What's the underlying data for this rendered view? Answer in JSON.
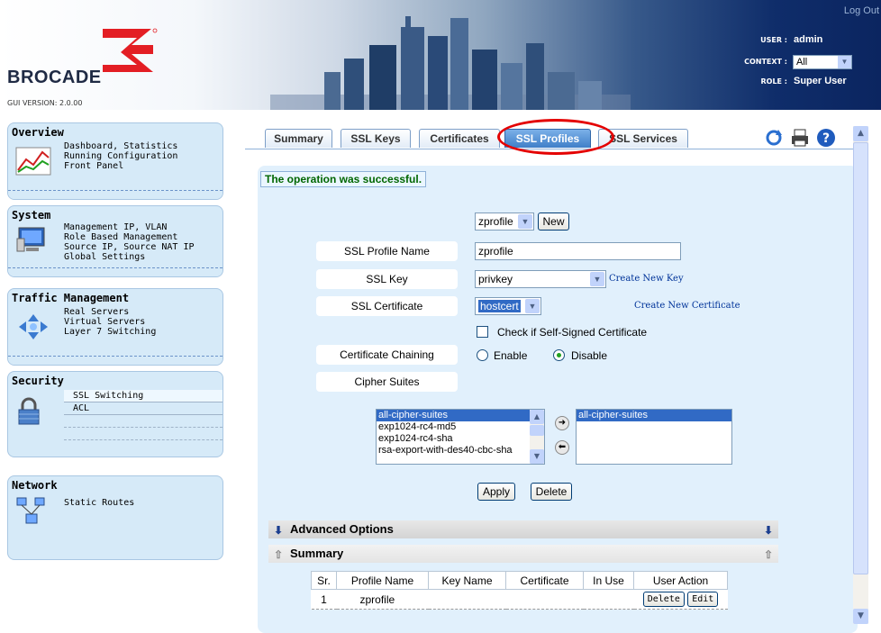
{
  "header": {
    "brand": "BROCADE",
    "gui_version": "GUI VERSION: 2.0.00",
    "logout": "Log Out",
    "user_label": "USER :",
    "user_value": "admin",
    "context_label": "CONTEXT :",
    "context_value": "All",
    "role_label": "ROLE :",
    "role_value": "Super User",
    "brand_color": "#e31e24"
  },
  "sidebar": {
    "overview": {
      "title": "Overview",
      "links": [
        "Dashboard, Statistics",
        "Running Configuration",
        "Front Panel"
      ]
    },
    "system": {
      "title": "System",
      "links": [
        "Management IP, VLAN",
        "Role Based Management",
        "Source IP, Source NAT IP",
        "Global Settings"
      ]
    },
    "traffic": {
      "title": "Traffic Management",
      "links": [
        "Real Servers",
        "Virtual Servers",
        "Layer 7 Switching"
      ]
    },
    "security": {
      "title": "Security",
      "links": [
        "SSL Switching",
        "ACL"
      ]
    },
    "network": {
      "title": "Network",
      "links": [
        "Static Routes"
      ]
    }
  },
  "tabs": [
    {
      "label": "Summary",
      "active": false
    },
    {
      "label": "SSL Keys",
      "active": false
    },
    {
      "label": "Certificates",
      "active": false
    },
    {
      "label": "SSL Profiles",
      "active": true
    },
    {
      "label": "SSL Services",
      "active": false
    }
  ],
  "status_message": "The operation was successful.",
  "form": {
    "profile_select": "zprofile",
    "new_button": "New",
    "profile_name_label": "SSL Profile Name",
    "profile_name_value": "zprofile",
    "ssl_key_label": "SSL Key",
    "ssl_key_value": "privkey",
    "create_key_link": "Create New Key",
    "ssl_cert_label": "SSL Certificate",
    "ssl_cert_value": "hostcert",
    "create_cert_link": "Create New Certificate",
    "self_signed_label": "Check if Self-Signed Certificate",
    "chaining_label": "Certificate Chaining",
    "enable_label": "Enable",
    "disable_label": "Disable",
    "chaining_value": "Disable",
    "cipher_label": "Cipher Suites",
    "available_ciphers": [
      "all-cipher-suites",
      "exp1024-rc4-md5",
      "exp1024-rc4-sha",
      "rsa-export-with-des40-cbc-sha"
    ],
    "selected_ciphers": [
      "all-cipher-suites"
    ],
    "apply_button": "Apply",
    "delete_button": "Delete"
  },
  "advanced_options": {
    "title": "Advanced Options"
  },
  "summary": {
    "title": "Summary",
    "columns": [
      "Sr.",
      "Profile Name",
      "Key Name",
      "Certificate",
      "In Use",
      "User Action"
    ],
    "rows": [
      {
        "sr": "1",
        "profile": "zprofile",
        "key": "",
        "cert": "",
        "in_use": "",
        "delete": "Delete",
        "edit": "Edit"
      }
    ]
  }
}
